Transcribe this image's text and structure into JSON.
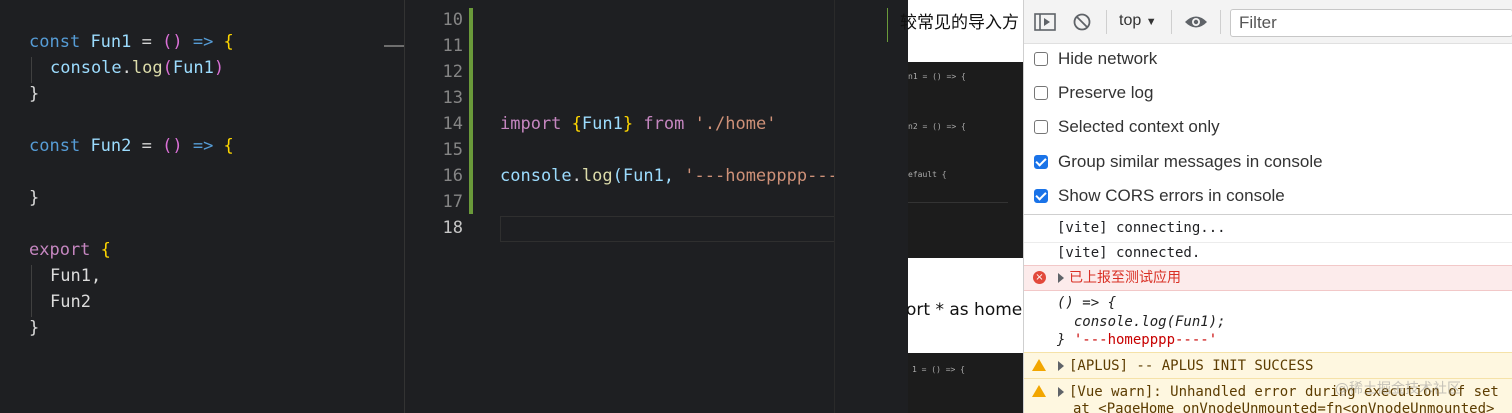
{
  "left_editor": {
    "lines": [
      {
        "kw": "const",
        "name": "Fun1",
        "eq": " = ",
        "params": "()",
        "arrow": " => ",
        "open": "{"
      },
      {
        "obj": "console",
        "method": "log",
        "arg": "Fun1"
      },
      {
        "close": "}"
      },
      {
        "kw": "const",
        "name": "Fun2",
        "eq": " = ",
        "params": "()",
        "arrow": " => ",
        "open": "{"
      },
      {
        "close": "}"
      },
      {
        "kw": "export",
        "open": "{"
      },
      {
        "item1": "Fun1,"
      },
      {
        "item2": "Fun2"
      },
      {
        "close": "}"
      }
    ]
  },
  "middle_editor": {
    "line_numbers": [
      "10",
      "11",
      "12",
      "13",
      "14",
      "15",
      "16",
      "17",
      "18"
    ],
    "import_line": {
      "kw": "import",
      "open": "{",
      "name": "Fun1",
      "close": "}",
      "from": "from",
      "path": "'./home'"
    },
    "console_line": {
      "obj": "console",
      "method": "log",
      "args_start": "(Fun1, ",
      "str": "'---homepppp---"
    }
  },
  "preview": {
    "top_text": "较常见的导入方",
    "mid_text": "ort * as home",
    "mini1": "n1 = () => {",
    "mini2": "n2 = () => {",
    "mini3": "efault {",
    "mini4": "1 = () => {"
  },
  "devtools": {
    "context": "top",
    "filter_placeholder": "Filter",
    "options": [
      {
        "label": "Hide network",
        "checked": false
      },
      {
        "label": "Preserve log",
        "checked": false
      },
      {
        "label": "Selected context only",
        "checked": false
      },
      {
        "label": "Group similar messages in console",
        "checked": true
      },
      {
        "label": "Show CORS errors in console",
        "checked": true
      }
    ],
    "messages": {
      "m1": "[vite] connecting...",
      "m2": "[vite] connected.",
      "error": "已上报至测试应用",
      "fn1": "() => {",
      "fn2": "  console.log(Fun1);",
      "fn3": "} ",
      "fn3_str": "'---homepppp----'",
      "warn1": "[APLUS] -- APLUS INIT SUCCESS",
      "warn2a": "[Vue warn]: Unhandled error during execution of set",
      "warn2b": "at <PageHome onVnodeUnmounted=fn<onVnodeUnmounted>"
    },
    "colors": {
      "error": "#d93025",
      "warning": "#f2a600",
      "checkbox": "#1a73e8"
    }
  },
  "watermark": "@稀土掘金技术社区"
}
